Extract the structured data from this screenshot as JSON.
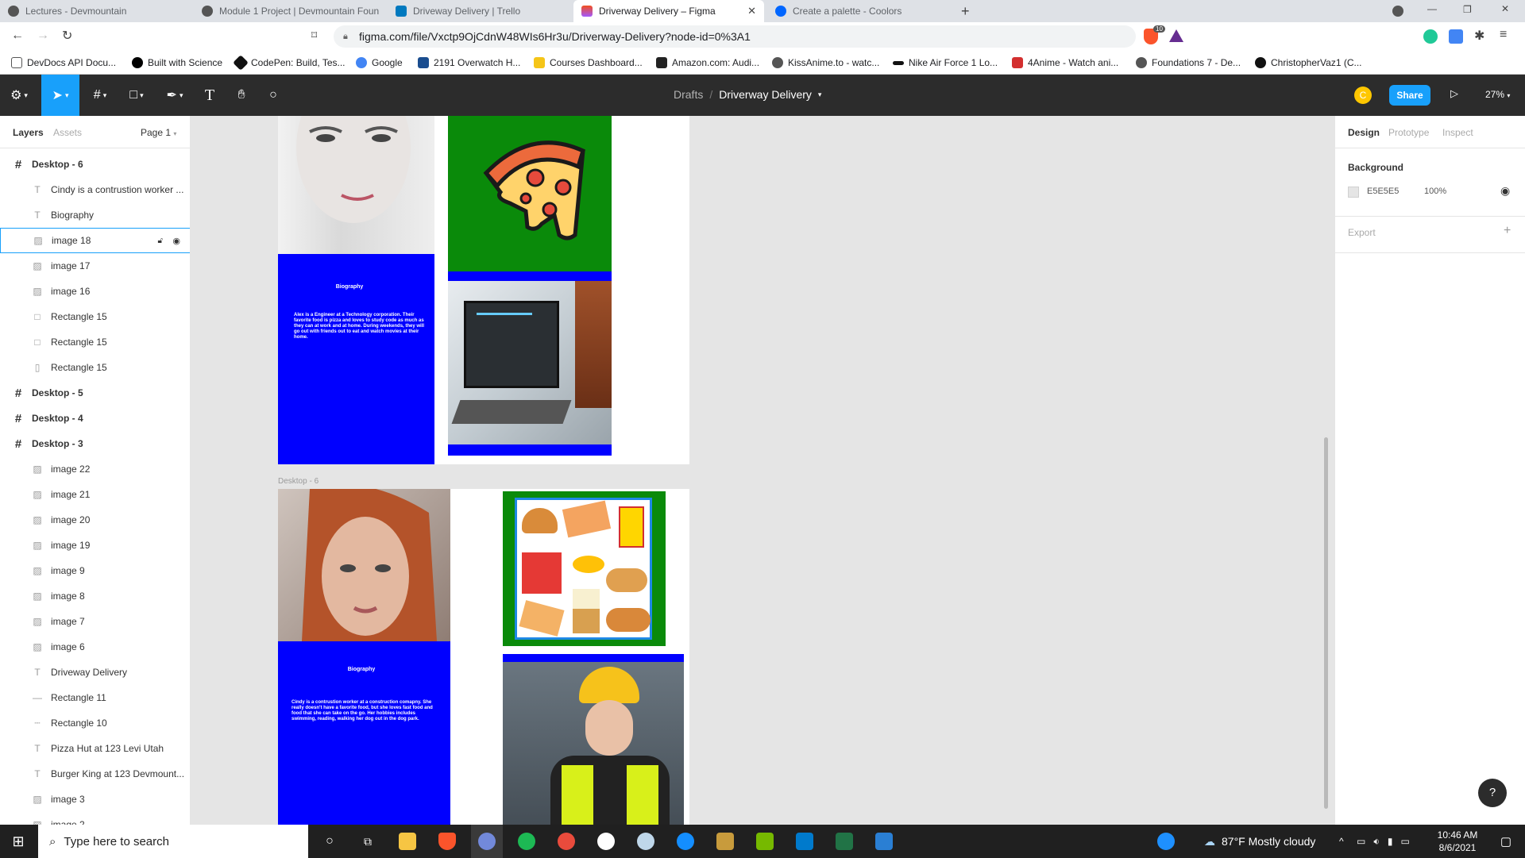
{
  "browser": {
    "tabs": [
      {
        "title": "Lectures - Devmountain",
        "active": false
      },
      {
        "title": "Module 1 Project | Devmountain Foun",
        "active": false
      },
      {
        "title": "Driveway Delivery | Trello",
        "active": false
      },
      {
        "title": "Driverway Delivery – Figma",
        "active": true
      },
      {
        "title": "Create a palette - Coolors",
        "active": false
      }
    ],
    "url": "figma.com/file/Vxctp9OjCdnW48WIs6Hr3u/Driverway-Delivery?node-id=0%3A1",
    "bookmarks": [
      "DevDocs API Docu...",
      "Built with Science",
      "CodePen: Build, Tes...",
      "Google",
      "2191 Overwatch H...",
      "Courses Dashboard...",
      "Amazon.com: Audi...",
      "KissAnime.to - watc...",
      "Nike Air Force 1 Lo...",
      "4Anime - Watch ani...",
      "Foundations 7 - De...",
      "ChristopherVaz1 (C..."
    ],
    "extension_badge": "10"
  },
  "figma": {
    "breadcrumb": {
      "parent": "Drafts",
      "separator": "/",
      "file": "Driverway Delivery"
    },
    "avatar_initial": "C",
    "share_label": "Share",
    "zoom": "27%",
    "left_tabs": {
      "layers": "Layers",
      "assets": "Assets",
      "page": "Page 1"
    },
    "layers": [
      {
        "label": "Desktop - 6",
        "kind": "frame",
        "indent": 0
      },
      {
        "label": "Cindy is a contrustion worker ...",
        "kind": "text",
        "indent": 1
      },
      {
        "label": "Biography",
        "kind": "text",
        "indent": 1
      },
      {
        "label": "image 18",
        "kind": "image",
        "indent": 1,
        "selected": true
      },
      {
        "label": "image 17",
        "kind": "image",
        "indent": 1
      },
      {
        "label": "image 16",
        "kind": "image",
        "indent": 1
      },
      {
        "label": "Rectangle 15",
        "kind": "rect",
        "indent": 1
      },
      {
        "label": "Rectangle 15",
        "kind": "rect",
        "indent": 1
      },
      {
        "label": "Rectangle 15",
        "kind": "rectv",
        "indent": 1
      },
      {
        "label": "Desktop - 5",
        "kind": "frame",
        "indent": 0
      },
      {
        "label": "Desktop - 4",
        "kind": "frame",
        "indent": 0
      },
      {
        "label": "Desktop - 3",
        "kind": "frame",
        "indent": 0
      },
      {
        "label": "image 22",
        "kind": "image",
        "indent": 1
      },
      {
        "label": "image 21",
        "kind": "image",
        "indent": 1
      },
      {
        "label": "image 20",
        "kind": "image",
        "indent": 1
      },
      {
        "label": "image 19",
        "kind": "image",
        "indent": 1
      },
      {
        "label": "image 9",
        "kind": "image",
        "indent": 1
      },
      {
        "label": "image 8",
        "kind": "image",
        "indent": 1
      },
      {
        "label": "image 7",
        "kind": "image",
        "indent": 1
      },
      {
        "label": "image 6",
        "kind": "image",
        "indent": 1
      },
      {
        "label": "Driveway Delivery",
        "kind": "text",
        "indent": 1
      },
      {
        "label": "Rectangle 11",
        "kind": "line",
        "indent": 1
      },
      {
        "label": "Rectangle 10",
        "kind": "dash",
        "indent": 1
      },
      {
        "label": "Pizza Hut at 123 Levi Utah",
        "kind": "text",
        "indent": 1
      },
      {
        "label": "Burger King at 123 Devmount...",
        "kind": "text",
        "indent": 1
      },
      {
        "label": "image 3",
        "kind": "image",
        "indent": 1
      },
      {
        "label": "image 2",
        "kind": "image",
        "indent": 1
      }
    ],
    "right_tabs": {
      "design": "Design",
      "prototype": "Prototype",
      "inspect": "Inspect"
    },
    "background": {
      "label": "Background",
      "hex": "E5E5E5",
      "opacity": "100%"
    },
    "export_label": "Export",
    "canvas": {
      "frame_label": "Desktop - 6",
      "top_frame": {
        "bio_title": "Biography",
        "bio_text": "Alex is a Engineer at a Technology corporation. Their favorite food is pizza and loves to study code as much as they can at work and at home. During weekends, they will go out with friends out to eat and watch movies at their home."
      },
      "bottom_frame": {
        "bio_title": "Biography",
        "bio_text": "Cindy is a contrustion worker at a construction comapny. She really doesn't have a favorite food, but she loves fast food and food that she can take on the go. Her hobbies includes swimming, reading, walking her dog out in the dog park."
      }
    },
    "help": "?"
  },
  "taskbar": {
    "search_placeholder": "Type here to search",
    "weather": "87°F  Mostly cloudy",
    "time": "10:46 AM",
    "date": "8/6/2021"
  },
  "colors": {
    "accent": "#18a0fb",
    "bio_blue": "#0000ff",
    "pizza_green": "#0a8a0a"
  }
}
